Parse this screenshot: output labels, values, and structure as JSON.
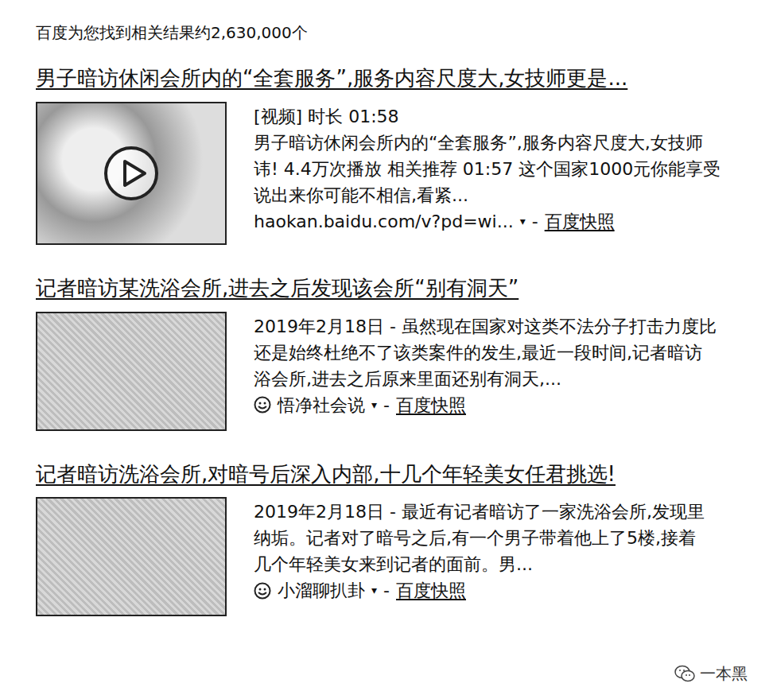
{
  "summary": "百度为您找到相关结果约2,630,000个",
  "results": [
    {
      "kind": "video",
      "title": "男子暗访休闲会所内的“全套服务”,服务内容尺度大,女技师更是...",
      "lines": [
        "[视频] 时长 01:58",
        "男子暗访休闲会所内的“全套服务”,服务内容尺度大,女技师",
        "讳! 4.4万次播放 相关推荐 01:57 这个国家1000元你能享受",
        "说出来你可能不相信,看紧..."
      ],
      "source": {
        "name": "haokan.baidu.com/v?pd=wi...",
        "arrow": "▾",
        "separator": "-",
        "snapshot": "百度快照"
      }
    },
    {
      "kind": "article",
      "title": "记者暗访某洗浴会所,进去之后发现该会所“别有洞天”",
      "lines": [
        "2019年2月18日 - 虽然现在国家对这类不法分子打击力度比",
        "还是始终杜绝不了该类案件的发生,最近一段时间,记者暗访",
        "浴会所,进去之后原来里面还别有洞天,..."
      ],
      "source": {
        "name": "悟净社会说",
        "arrow": "▾",
        "separator": "-",
        "snapshot": "百度快照"
      }
    },
    {
      "kind": "article",
      "title": "记者暗访洗浴会所,对暗号后深入内部,十几个年轻美女任君挑选!",
      "lines": [
        "2019年2月18日 - 最近有记者暗访了一家洗浴会所,发现里",
        "纳垢。记者对了暗号之后,有一个男子带着他上了5楼,接着",
        "几个年轻美女来到记者的面前。男..."
      ],
      "source": {
        "name": "小溜聊扒卦",
        "arrow": "▾",
        "separator": "-",
        "snapshot": "百度快照"
      }
    }
  ],
  "watermark": "一本黑"
}
